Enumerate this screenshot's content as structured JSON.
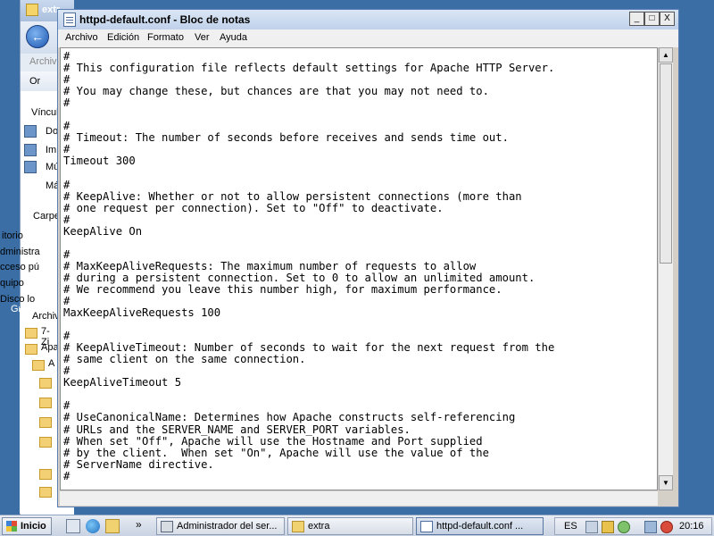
{
  "background_window": {
    "title": "extr",
    "menu_archivo": "Archiv",
    "tool_label": "Or",
    "links_header": "Víncul",
    "links": [
      "Do",
      "Im",
      "Mú",
      "Má"
    ],
    "folders_header": "Carpe",
    "left_items": [
      "itorio",
      "dministra",
      "cceso pú",
      "quipo",
      "Disco lo"
    ],
    "left_edge_text": "Gr",
    "tree": [
      "Archiv",
      "7-Zi",
      "Apa",
      "A"
    ]
  },
  "notepad": {
    "title": "httpd-default.conf - Bloc de notas",
    "menu": [
      "Archivo",
      "Edición",
      "Formato",
      "Ver",
      "Ayuda"
    ],
    "window_buttons": [
      "_",
      "□",
      "X"
    ],
    "content": "#\n# This configuration file reflects default settings for Apache HTTP Server.\n#\n# You may change these, but chances are that you may not need to.\n#\n\n#\n# Timeout: The number of seconds before receives and sends time out.\n#\nTimeout 300\n\n#\n# KeepAlive: Whether or not to allow persistent connections (more than\n# one request per connection). Set to \"Off\" to deactivate.\n#\nKeepAlive On\n\n#\n# MaxKeepAliveRequests: The maximum number of requests to allow\n# during a persistent connection. Set to 0 to allow an unlimited amount.\n# We recommend you leave this number high, for maximum performance.\n#\nMaxKeepAliveRequests 100\n\n#\n# KeepAliveTimeout: Number of seconds to wait for the next request from the\n# same client on the same connection.\n#\nKeepAliveTimeout 5\n\n#\n# UseCanonicalName: Determines how Apache constructs self-referencing\n# URLs and the SERVER_NAME and SERVER_PORT variables.\n# When set \"Off\", Apache will use the Hostname and Port supplied\n# by the client.  When set \"On\", Apache will use the value of the\n# ServerName directive.\n#"
  },
  "taskbar": {
    "start_label": "Inicio",
    "overflow": "»",
    "tasks": [
      {
        "label": "Administrador del ser...",
        "icon": "server-manager-icon"
      },
      {
        "label": "extra",
        "icon": "folder-icon"
      },
      {
        "label": "httpd-default.conf ...",
        "icon": "notepad-icon"
      }
    ],
    "language": "ES",
    "clock": "20:16"
  },
  "colors": {
    "desktop": "#3a6ea5",
    "title_bar": "#bfd1ea"
  }
}
